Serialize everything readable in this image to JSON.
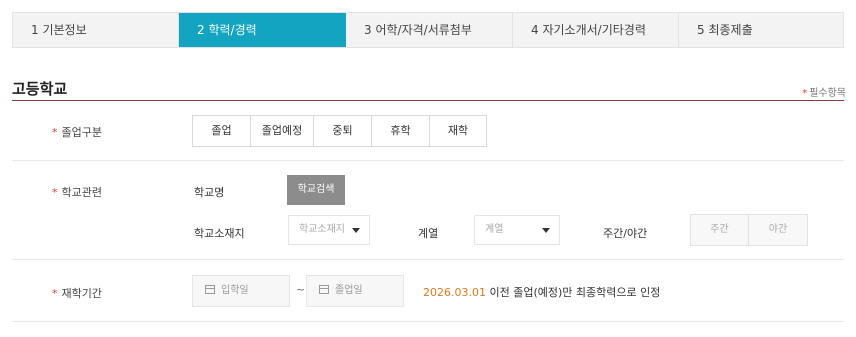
{
  "steps": [
    {
      "label": "1  기본정보"
    },
    {
      "label": "2  학력/경력"
    },
    {
      "label": "3  어학/자격/서류첨부"
    },
    {
      "label": "4  자기소개서/기타경력"
    },
    {
      "label": "5  최종제출"
    }
  ],
  "section": {
    "title": "고등학교",
    "required_note": "필수항목",
    "required_mark": "*"
  },
  "graduation": {
    "label": "졸업구분",
    "options": [
      "졸업",
      "졸업예정",
      "중퇴",
      "휴학",
      "재학"
    ]
  },
  "school": {
    "label": "학교관련",
    "name_label": "학교명",
    "search_button": "학교검색",
    "location_label": "학교소재지",
    "location_select": "학교소재지",
    "track_label": "계열",
    "track_select": "계열",
    "daynight_label": "주간/야간",
    "day_option": "주간",
    "night_option": "야간"
  },
  "period": {
    "label": "재학기간",
    "entry_placeholder": "입학일",
    "grad_placeholder": "졸업일",
    "separator": "~",
    "note_date": "2026.03.01",
    "note_text": " 이전 졸업(예정)만 최종학력으로 인정"
  },
  "colors": {
    "active_step": "#12a4c0",
    "required": "#e03c31",
    "highlight": "#e07b1d"
  }
}
